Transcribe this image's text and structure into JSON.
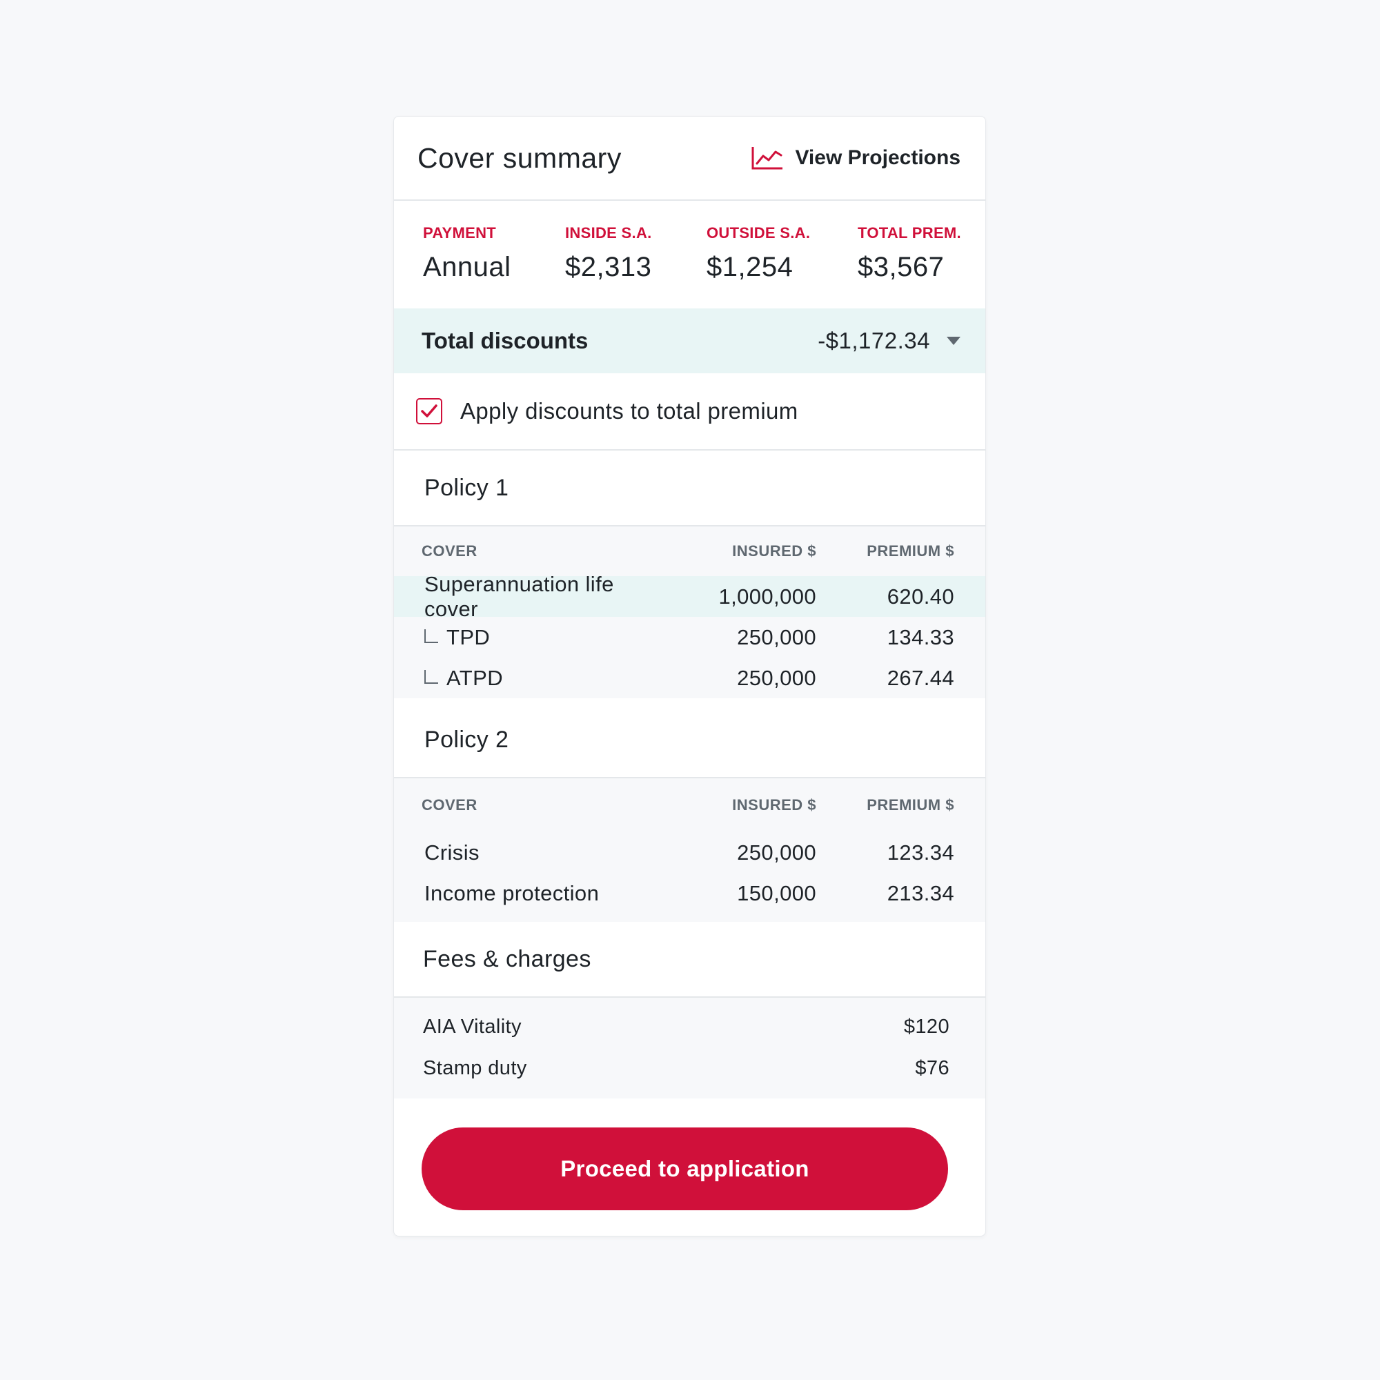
{
  "header": {
    "title": "Cover summary",
    "projections_label": "View Projections",
    "projections_icon": "line-chart-icon"
  },
  "summary": [
    {
      "label": "PAYMENT",
      "value": "Annual"
    },
    {
      "label": "INSIDE S.A.",
      "value": "$2,313"
    },
    {
      "label": "OUTSIDE S.A.",
      "value": "$1,254"
    },
    {
      "label": "TOTAL PREM.",
      "value": "$3,567"
    }
  ],
  "discounts": {
    "label": "Total discounts",
    "value": "-$1,172.34",
    "expanded": false
  },
  "apply_discounts": {
    "label": "Apply discounts to total premium",
    "checked": true
  },
  "table_headers": {
    "cover": "COVER",
    "insured": "INSURED $",
    "premium": "PREMIUM $"
  },
  "policies": [
    {
      "title": "Policy 1",
      "rows": [
        {
          "cover": "Superannuation life cover",
          "insured": "1,000,000",
          "premium": "620.40"
        },
        {
          "cover": "TPD",
          "insured": "250,000",
          "premium": "134.33"
        },
        {
          "cover": "ATPD",
          "insured": "250,000",
          "premium": "267.44"
        }
      ]
    },
    {
      "title": "Policy 2",
      "rows": [
        {
          "cover": "Crisis",
          "insured": "250,000",
          "premium": "123.34"
        },
        {
          "cover": "Income protection",
          "insured": "150,000",
          "premium": "213.34"
        }
      ]
    }
  ],
  "fees": {
    "title": "Fees & charges",
    "items": [
      {
        "label": "AIA Vitality",
        "value": "$120"
      },
      {
        "label": "Stamp duty",
        "value": "$76"
      }
    ]
  },
  "cta": {
    "label": "Proceed to application"
  },
  "colors": {
    "accent": "#d0103a",
    "highlight": "#e8f5f5",
    "background": "#f7f8fa",
    "text": "#1e2328",
    "muted": "#5f6870"
  }
}
